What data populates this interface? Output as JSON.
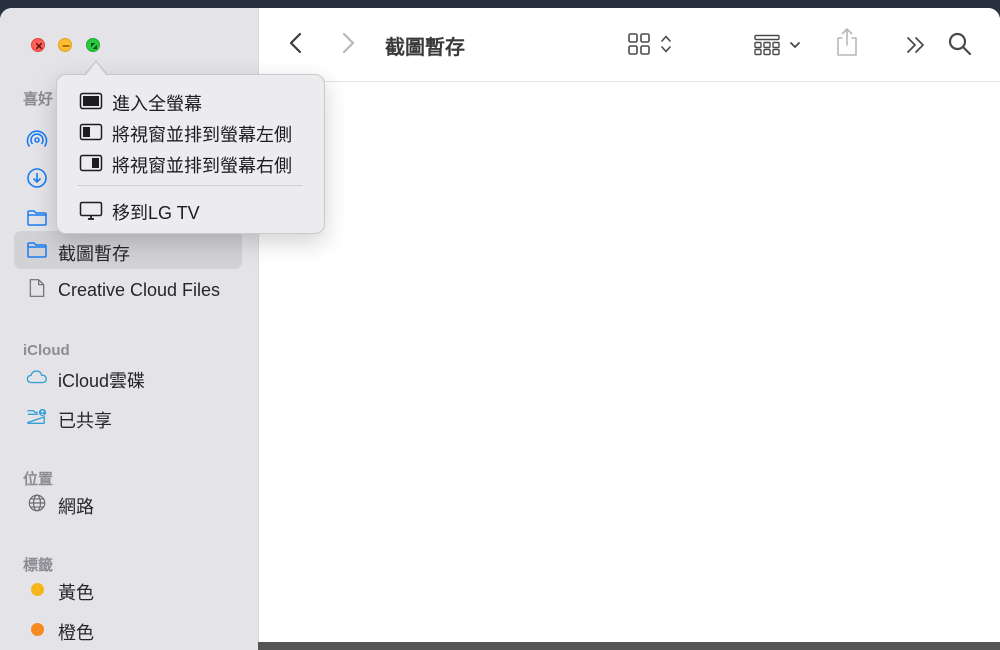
{
  "window": {
    "title": "截圖暫存"
  },
  "sidebar": {
    "sections": {
      "favorites": "喜好",
      "icloud": "iCloud",
      "locations": "位置",
      "tags": "標籤"
    },
    "items": [
      {
        "label": "截圖暫存",
        "icon": "folder-icon"
      },
      {
        "label": "Creative Cloud Files",
        "icon": "document-icon"
      },
      {
        "label": "iCloud雲碟",
        "icon": "cloud-icon"
      },
      {
        "label": "已共享",
        "icon": "shared-folder-icon"
      },
      {
        "label": "網路",
        "icon": "globe-icon"
      },
      {
        "label": "黃色",
        "icon": "tag-dot",
        "color": "#f5b619"
      },
      {
        "label": "橙色",
        "icon": "tag-dot",
        "color": "#f6891f"
      }
    ],
    "selected_index": 0
  },
  "menu": {
    "items": [
      {
        "label": "進入全螢幕",
        "icon": "fullscreen-icon"
      },
      {
        "label": "將視窗並排到螢幕左側",
        "icon": "tile-left-icon"
      },
      {
        "label": "將視窗並排到螢幕右側",
        "icon": "tile-right-icon"
      },
      {
        "label": "移到LG TV",
        "icon": "display-icon"
      }
    ]
  },
  "colors": {
    "accent": "#1a7cf2",
    "sidebar_bg": "#e4e3e8",
    "selected_bg": "#d2d1d6"
  }
}
